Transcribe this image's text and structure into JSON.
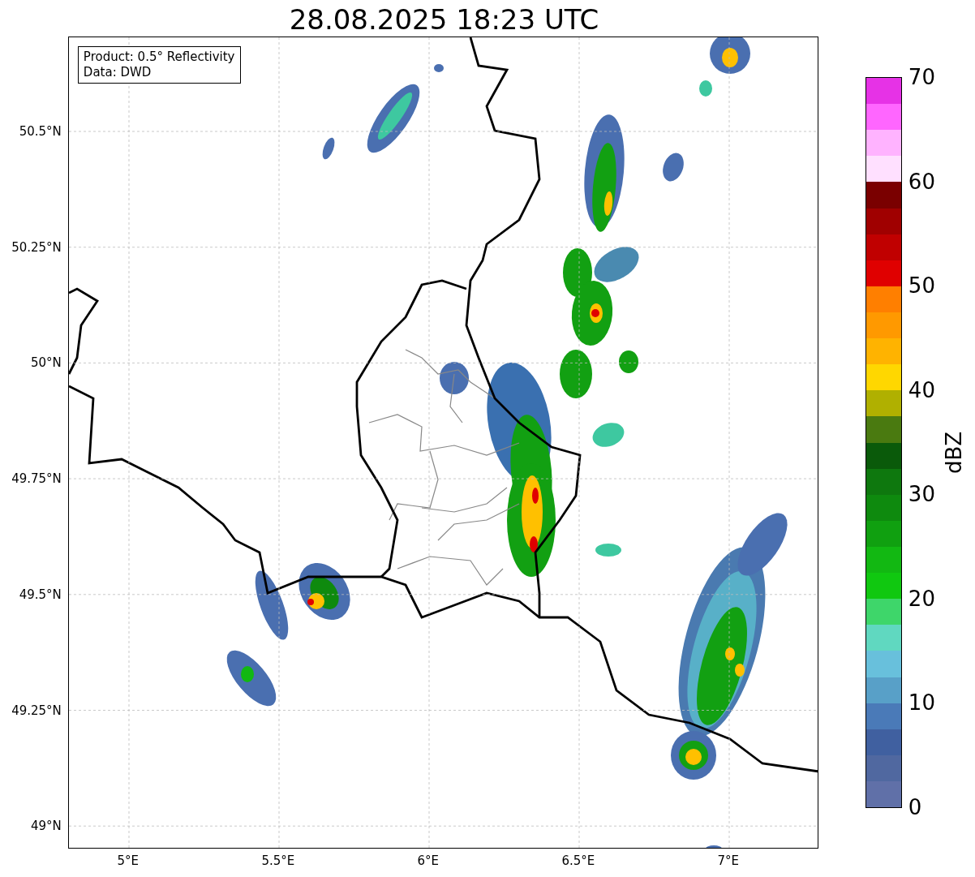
{
  "title": "28.08.2025 18:23 UTC",
  "info_box": [
    "Product: 0.5° Reflectivity",
    "Data: DWD"
  ],
  "x_axis": {
    "ticks": [
      "5°E",
      "5.5°E",
      "6°E",
      "6.5°E",
      "7°E"
    ]
  },
  "y_axis": {
    "ticks": [
      "50.5°N",
      "50.25°N",
      "50°N",
      "49.75°N",
      "49.5°N",
      "49.25°N",
      "49°N"
    ]
  },
  "colorbar": {
    "label": "dBZ",
    "ticks": [
      "70",
      "60",
      "50",
      "40",
      "30",
      "20",
      "10",
      "0"
    ],
    "segments": [
      {
        "color": "#e632e6"
      },
      {
        "color": "#ff66ff"
      },
      {
        "color": "#ffb3ff"
      },
      {
        "color": "#ffe0ff"
      },
      {
        "color": "#7a0000"
      },
      {
        "color": "#a00000"
      },
      {
        "color": "#c00000"
      },
      {
        "color": "#e00000"
      },
      {
        "color": "#ff7f00"
      },
      {
        "color": "#ff9900"
      },
      {
        "color": "#ffb300"
      },
      {
        "color": "#ffd700"
      },
      {
        "color": "#b0b000"
      },
      {
        "color": "#4a7a10"
      },
      {
        "color": "#0a5a0a"
      },
      {
        "color": "#0e780e"
      },
      {
        "color": "#0e8a0e"
      },
      {
        "color": "#10a010"
      },
      {
        "color": "#12b812"
      },
      {
        "color": "#10c810"
      },
      {
        "color": "#3ed66a"
      },
      {
        "color": "#60d8c0"
      },
      {
        "color": "#68c0dc"
      },
      {
        "color": "#58a0c8"
      },
      {
        "color": "#4a7ab8"
      },
      {
        "color": "#4060a0"
      },
      {
        "color": "#5068a0"
      },
      {
        "color": "#6070a8"
      }
    ]
  }
}
